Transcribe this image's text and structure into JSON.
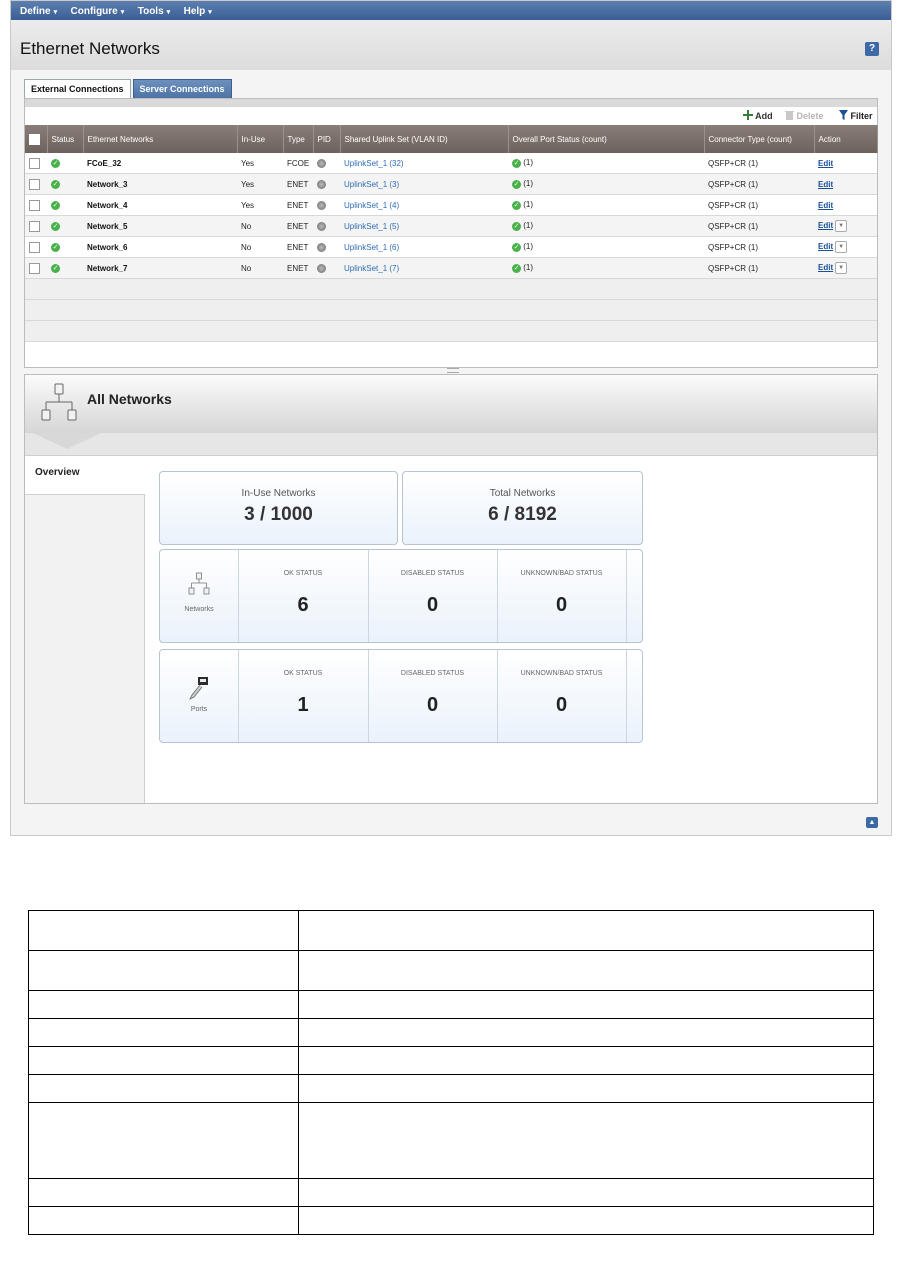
{
  "menu": [
    {
      "label": "Define",
      "caret": "▾"
    },
    {
      "label": "Configure",
      "caret": "▾"
    },
    {
      "label": "Tools",
      "caret": "▾"
    },
    {
      "label": "Help",
      "caret": "▾"
    }
  ],
  "page": {
    "title": "Ethernet Networks",
    "help_icon_text": "?"
  },
  "tabs": [
    {
      "label": "External Connections",
      "active": true
    },
    {
      "label": "Server Connections",
      "active": false
    }
  ],
  "toolbar": {
    "add": "Add",
    "delete": "Delete",
    "filter": "Filter"
  },
  "columns": [
    "Status",
    "Ethernet Networks",
    "In-Use",
    "Type",
    "PID",
    "Shared Uplink Set (VLAN ID)",
    "Overall Port Status (count)",
    "Connector Type (count)",
    "Action"
  ],
  "rows": [
    {
      "name": "FCoE_32",
      "in_use": "Yes",
      "type": "FCOE",
      "uplink": "UplinkSet_1 (32)",
      "port_status": "(1)",
      "connector": "QSFP+CR (1)",
      "action": "Edit",
      "dropdown": false
    },
    {
      "name": "Network_3",
      "in_use": "Yes",
      "type": "ENET",
      "uplink": "UplinkSet_1 (3)",
      "port_status": "(1)",
      "connector": "QSFP+CR (1)",
      "action": "Edit",
      "dropdown": false
    },
    {
      "name": "Network_4",
      "in_use": "Yes",
      "type": "ENET",
      "uplink": "UplinkSet_1 (4)",
      "port_status": "(1)",
      "connector": "QSFP+CR (1)",
      "action": "Edit",
      "dropdown": false
    },
    {
      "name": "Network_5",
      "in_use": "No",
      "type": "ENET",
      "uplink": "UplinkSet_1 (5)",
      "port_status": "(1)",
      "connector": "QSFP+CR (1)",
      "action": "Edit",
      "dropdown": true
    },
    {
      "name": "Network_6",
      "in_use": "No",
      "type": "ENET",
      "uplink": "UplinkSet_1 (6)",
      "port_status": "(1)",
      "connector": "QSFP+CR (1)",
      "action": "Edit",
      "dropdown": true
    },
    {
      "name": "Network_7",
      "in_use": "No",
      "type": "ENET",
      "uplink": "UplinkSet_1 (7)",
      "port_status": "(1)",
      "connector": "QSFP+CR (1)",
      "action": "Edit",
      "dropdown": true
    }
  ],
  "details": {
    "title": "All Networks",
    "overview_tab": "Overview",
    "inuse": {
      "label": "In-Use Networks",
      "value": "3 / 1000"
    },
    "total": {
      "label": "Total Networks",
      "value": "6 / 8192"
    },
    "networks_row": {
      "icon_label": "Networks",
      "ok_label": "OK STATUS",
      "ok_value": "6",
      "disabled_label": "DISABLED STATUS",
      "disabled_value": "0",
      "unknown_label": "UNKNOWN/BAD STATUS",
      "unknown_value": "0"
    },
    "ports_row": {
      "icon_label": "Ports",
      "ok_label": "OK STATUS",
      "ok_value": "1",
      "disabled_label": "DISABLED STATUS",
      "disabled_value": "0",
      "unknown_label": "UNKNOWN/BAD STATUS",
      "unknown_value": "0"
    }
  },
  "colors": {
    "menubar": "#3a5f95",
    "ok_green": "#48b24a",
    "header_brown": "#6e625c",
    "link_blue": "#2d6cb5"
  },
  "icons": [
    "checkmark-icon",
    "pid-indicator-icon",
    "plus-icon",
    "trash-icon",
    "filter-icon",
    "network-topology-icon",
    "port-plug-icon",
    "help-icon",
    "collapse-up-icon",
    "chevron-down-icon"
  ]
}
